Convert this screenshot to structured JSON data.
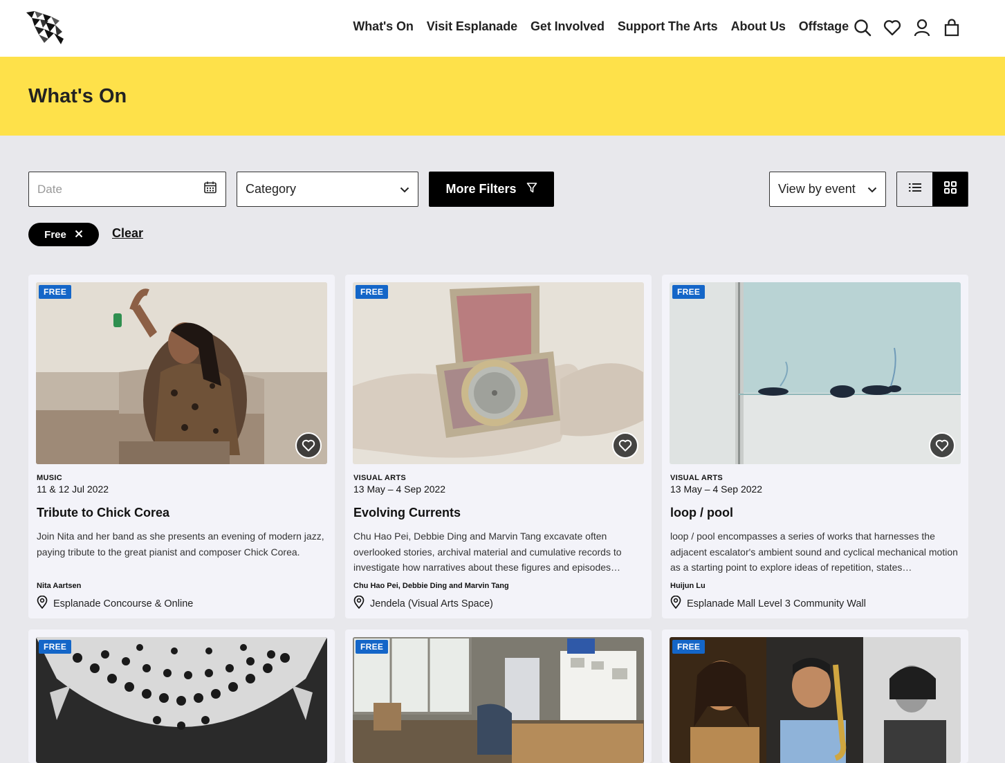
{
  "header": {
    "nav": [
      "What's On",
      "Visit Esplanade",
      "Get Involved",
      "Support The Arts",
      "About Us",
      "Offstage"
    ],
    "icons": [
      "search-icon",
      "heart-icon",
      "user-icon",
      "bag-icon"
    ]
  },
  "banner": {
    "title": "What's On"
  },
  "filters": {
    "date_placeholder": "Date",
    "category_label": "Category",
    "more_filters_label": "More Filters",
    "view_by_label": "View by event",
    "chip_label": "Free",
    "clear_label": "Clear"
  },
  "cards": [
    {
      "badge": "FREE",
      "category": "MUSIC",
      "date": "11 & 12 Jul 2022",
      "title": "Tribute to Chick Corea",
      "description": "Join Nita and her band as she presents an evening of modern jazz, paying tribute to the great pianist and composer Chick Corea.",
      "artist": "Nita Aartsen",
      "venue": "Esplanade Concourse & Online"
    },
    {
      "badge": "FREE",
      "category": "VISUAL ARTS",
      "date": "13 May – 4 Sep 2022",
      "title": "Evolving Currents",
      "description": "Chu Hao Pei, Debbie Ding and Marvin Tang excavate often overlooked stories, archival material and cumulative records to investigate how narratives about these figures and episodes…",
      "artist": "Chu Hao Pei, Debbie Ding and Marvin Tang",
      "venue": "Jendela (Visual Arts Space)"
    },
    {
      "badge": "FREE",
      "category": "VISUAL ARTS",
      "date": "13 May – 4 Sep 2022",
      "title": "loop / pool",
      "description": "loop / pool encompasses a series of works that harnesses the adjacent escalator's ambient sound and cyclical mechanical motion as a starting point to explore ideas of repetition, states…",
      "artist": "Huijun Lu",
      "venue": "Esplanade Mall Level 3 Community Wall"
    },
    {
      "badge": "FREE"
    },
    {
      "badge": "FREE"
    },
    {
      "badge": "FREE"
    }
  ]
}
